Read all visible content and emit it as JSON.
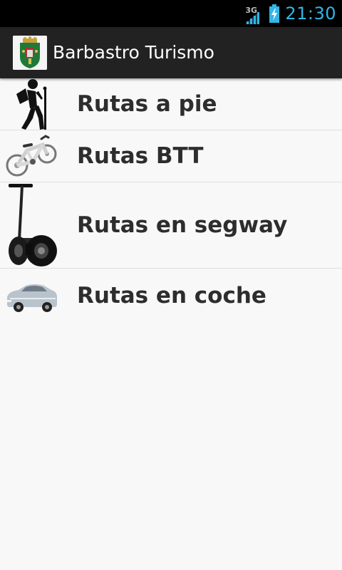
{
  "status_bar": {
    "network": "3G",
    "time": "21:30",
    "colors": {
      "clock": "#33b5e5"
    }
  },
  "action_bar": {
    "title": "Barbastro Turismo",
    "icon": "barbastro-coat-of-arms-icon"
  },
  "routes": [
    {
      "label": "Rutas a pie",
      "icon": "hiker-icon"
    },
    {
      "label": "Rutas BTT",
      "icon": "bicycle-icon"
    },
    {
      "label": "Rutas en segway",
      "icon": "segway-icon"
    },
    {
      "label": "Rutas en coche",
      "icon": "car-icon"
    }
  ]
}
